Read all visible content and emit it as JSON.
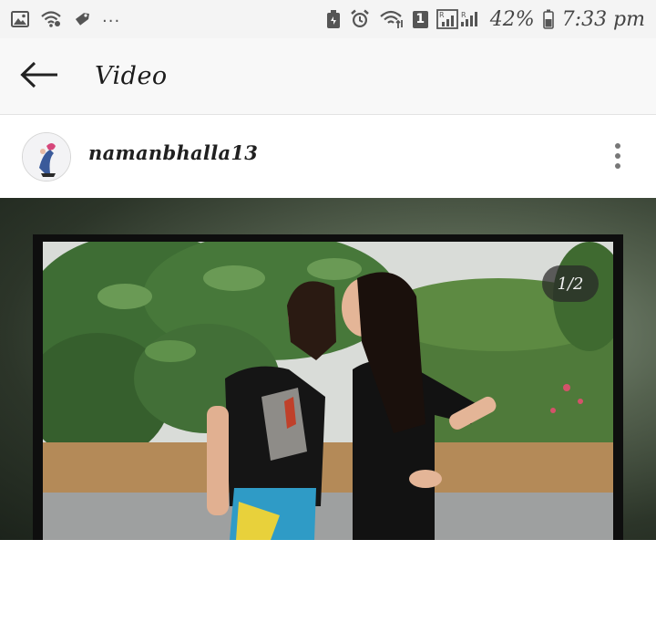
{
  "status_bar": {
    "battery_percent": "42%",
    "time": "7:33 pm",
    "sim_badge": "1",
    "overflow": "...",
    "icons": [
      "image-icon",
      "wifi-icon",
      "tag-icon",
      "alarm-icon",
      "battery-saver-icon",
      "wifi-calling-icon",
      "signal-icon",
      "battery-icon"
    ]
  },
  "app_bar": {
    "title": "Video",
    "back_icon": "arrow-left-icon"
  },
  "post": {
    "username": "namanbhalla13",
    "more_icon": "more-vertical-icon",
    "media_page_indicator": "1/2"
  }
}
